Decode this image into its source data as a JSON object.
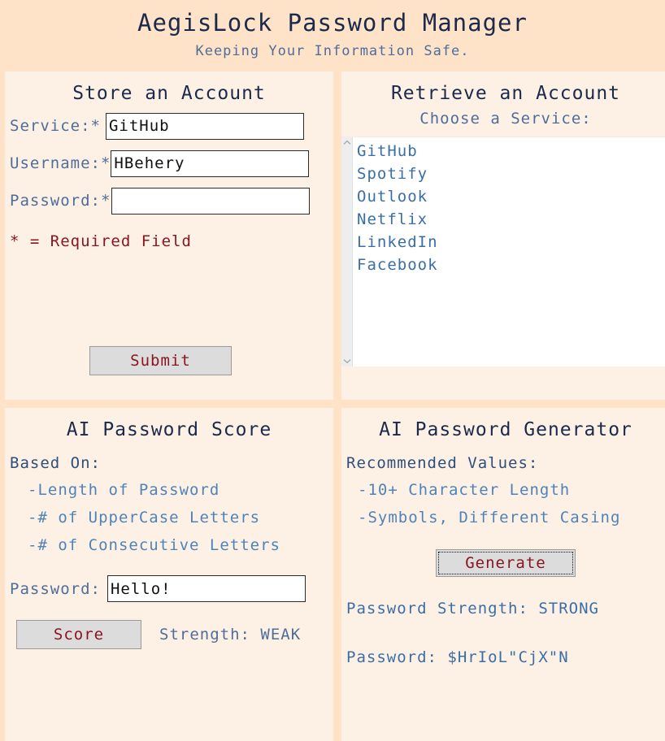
{
  "header": {
    "title": "AegisLock Password Manager",
    "subtitle": "Keeping Your Information Safe."
  },
  "colors": {
    "page_background": "#ffe3c9",
    "panel_background": "#fdf1e6",
    "title_text": "#1b2a4a",
    "label_text": "#4f6d99",
    "accent_red": "#8a1520",
    "link_blue": "#3a6ea5",
    "button_face": "#dcdcdc"
  },
  "store_panel": {
    "title": "Store an Account",
    "service_label": "Service:*",
    "service_value": "GitHub",
    "service_placeholder": "",
    "username_label": "Username:*",
    "username_value": "HBehery",
    "username_placeholder": "",
    "password_label": "Password:*",
    "password_value": "",
    "password_placeholder": "",
    "required_note": "* = Required Field",
    "submit_label": "Submit"
  },
  "retrieve_panel": {
    "title": "Retrieve an Account",
    "subtitle": "Choose a Service:",
    "options": [
      "GitHub",
      "Spotify",
      "Outlook",
      "Netflix",
      "LinkedIn",
      "Facebook"
    ],
    "selected_option": "",
    "scrollbar": {
      "up_icon": "chevron-up-icon",
      "down_icon": "chevron-down-icon"
    }
  },
  "score_panel": {
    "title": "AI Password Score",
    "based_on_label": "Based On:",
    "criteria": [
      "-Length of Password",
      "-# of UpperCase Letters",
      "-# of Consecutive Letters"
    ],
    "password_label": "Password:",
    "password_value": "Hello!",
    "password_placeholder": "",
    "score_button_label": "Score",
    "strength_text": "Strength: WEAK",
    "strength_value": "WEAK"
  },
  "generator_panel": {
    "title": "AI Password Generator",
    "recommended_label": "Recommended Values:",
    "recommendations": [
      "-10+ Character Length",
      "-Symbols, Different Casing"
    ],
    "generate_button_label": "Generate",
    "strength_line": "Password Strength: STRONG",
    "strength_value": "STRONG",
    "password_line": "Password: $HrIoL\"CjX\"N",
    "password_value": "$HrIoL\"CjX\"N"
  }
}
